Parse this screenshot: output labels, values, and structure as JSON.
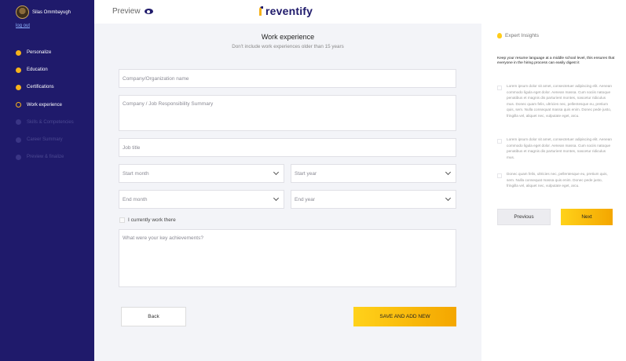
{
  "user": {
    "name": "Silas Ommbayugh",
    "logout": "log out"
  },
  "steps": [
    {
      "label": "Personalize",
      "state": "done"
    },
    {
      "label": "Education",
      "state": "done"
    },
    {
      "label": "Certifications",
      "state": "done"
    },
    {
      "label": "Work experience",
      "state": "current"
    },
    {
      "label": "Skills & Competencies",
      "state": "todo"
    },
    {
      "label": "Career Summary",
      "state": "todo"
    },
    {
      "label": "Preview & finalize",
      "state": "todo"
    }
  ],
  "header": {
    "preview": "Preview",
    "brand": "reventify"
  },
  "form": {
    "title": "Work experience",
    "subtitle": "Don't include work experiences older than 15 years",
    "company_placeholder": "Company/Organization name",
    "summary_placeholder": "Company / Job Responsibility Summary",
    "job_title_placeholder": "Job title",
    "start_month": "Start month",
    "start_year": "Start year",
    "end_month": "End month",
    "end_year": "End year",
    "current_label": "I currently work there",
    "achievements_placeholder": "What were your key achievements?",
    "back": "Back",
    "save_add": "SAVE AND ADD NEW"
  },
  "insights": {
    "title": "Expert Insights",
    "note": "Keep your resume language at a middle school level, this ensures that everyone in the hiring process can easily digest it",
    "tips": [
      "Lorem ipsum dolor sit amet, consectetuer adipiscing elit. Aenean commodo ligula eget dolor. Aenean massa. Cum sociis natoque penatibus et magnis dis parturient montes, nascetur ridiculus mus. Donec quam felis, ultricies nec, pellentesque eu, pretium quis, sem. Nulla consequat massa quis enim. Donec pede justo, fringilla vel, aliquet nec, vulputate eget, arcu.",
      "Lorem ipsum dolor sit amet, consectetuer adipiscing elit. Aenean commodo ligula eget dolor. Aenean massa. Cum sociis natoque penatibus et magnis dis parturient montes, nascetur ridiculus mus.",
      "Donec quam felis, ultricies nec, pellentesque eu, pretium quis, sem. Nulla consequat massa quis enim. Donec pede justo, fringilla vel, aliquet nec, vulputate eget, arcu."
    ],
    "previous": "Previous",
    "next": "Next"
  },
  "colors": {
    "sidebar": "#1f1a6b",
    "accent": "#f6b21b",
    "brand": "#1f1a6b"
  }
}
